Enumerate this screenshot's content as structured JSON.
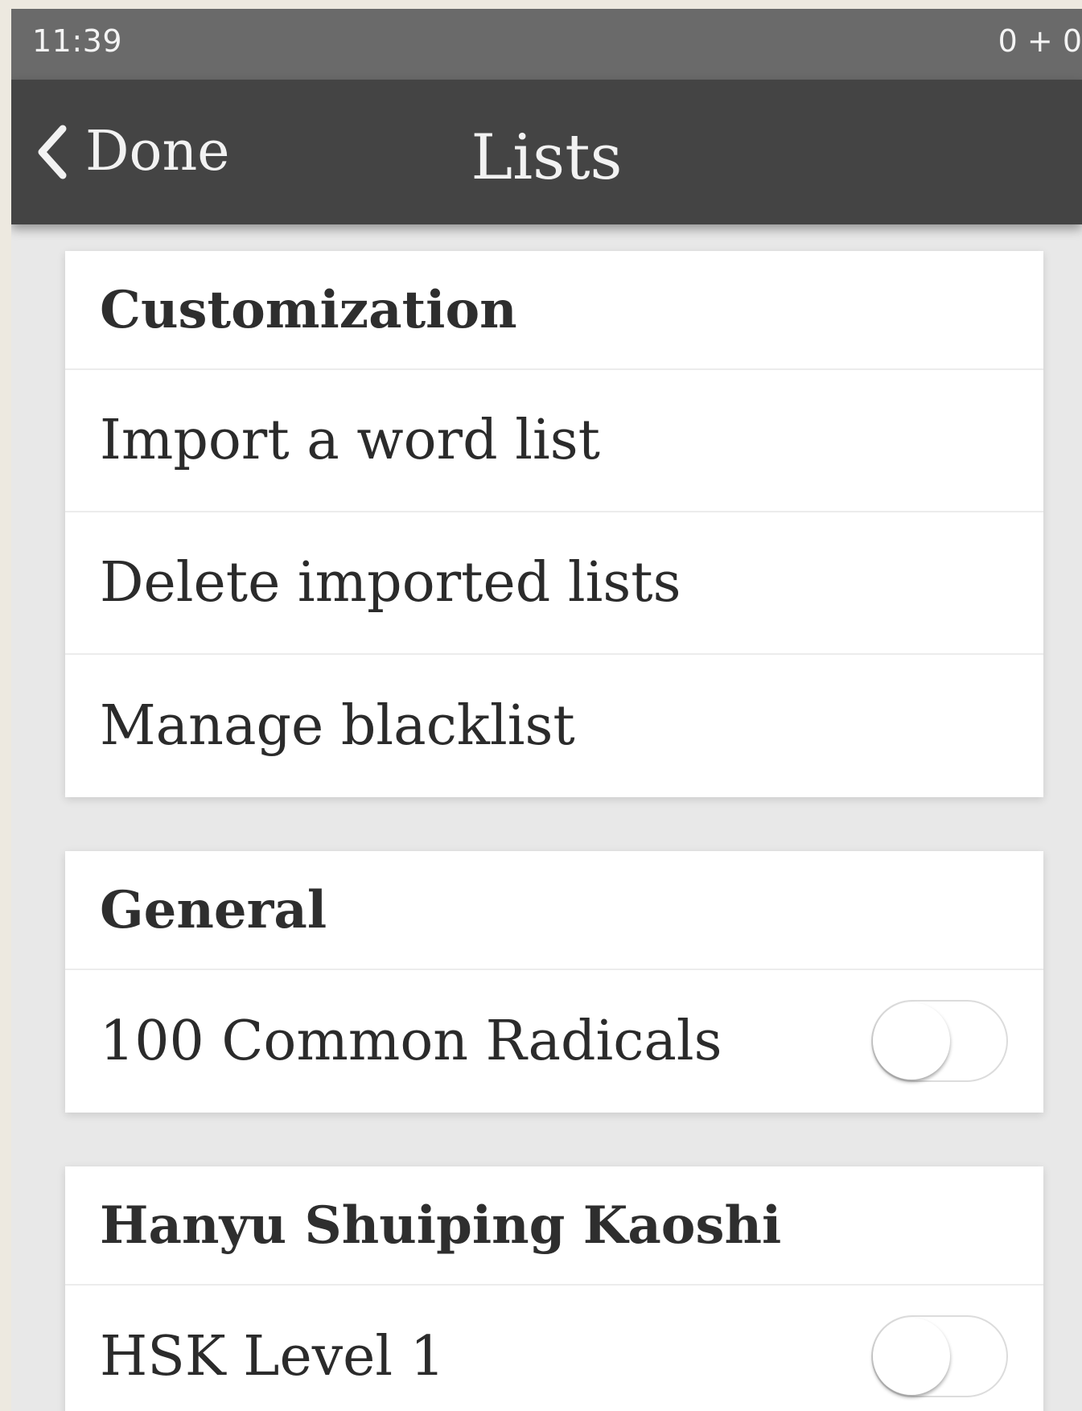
{
  "status_bar": {
    "time": "11:39",
    "right_text": "0 + 0"
  },
  "nav": {
    "back_label": "Done",
    "title": "Lists",
    "back_icon": "chevron-left-icon"
  },
  "sections": {
    "customization": {
      "header": "Customization",
      "items": [
        {
          "label": "Import a word list"
        },
        {
          "label": "Delete imported lists"
        },
        {
          "label": "Manage blacklist"
        }
      ]
    },
    "general": {
      "header": "General",
      "items": [
        {
          "label": "100 Common Radicals",
          "toggle_on": false
        }
      ]
    },
    "hsk": {
      "header": "Hanyu Shuiping Kaoshi",
      "items": [
        {
          "label": "HSK Level 1",
          "toggle_on": false
        }
      ]
    }
  },
  "colors": {
    "status_bar": "#6a6a6a",
    "nav_bar": "#444444",
    "background": "#e8e8e8",
    "card": "#ffffff"
  }
}
